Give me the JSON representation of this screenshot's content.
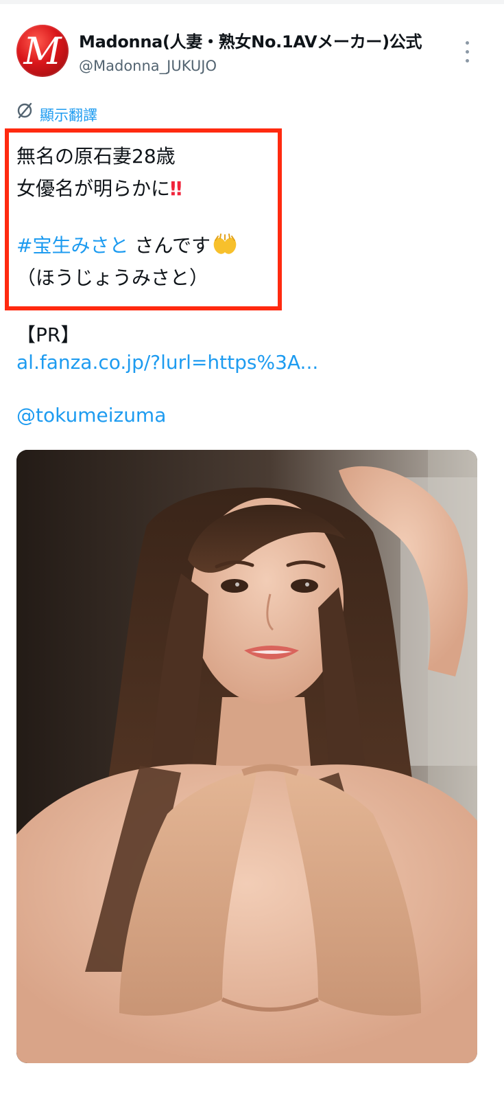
{
  "account": {
    "display_name": "Madonna(人妻・熟女No.1AVメーカー)公式",
    "handle": "@Madonna_JUKUJO",
    "avatar_letter": "M"
  },
  "translate": {
    "label": "顯示翻譯"
  },
  "tweet": {
    "line1": "無名の原石妻28歳",
    "line2": "女優名が明らかに",
    "line2_mark": "‼",
    "hashtag": "#宝生みさと",
    "line3_rest": " さんです",
    "line4": "（ほうじょうみさと）",
    "pr": "【PR】",
    "url": "al.fanza.co.jp/?lurl=https%3A...",
    "mention": "@tokumeizuma"
  },
  "colors": {
    "link": "#1d9bf0",
    "highlight": "#ff2a10",
    "text": "#0f1419",
    "secondary": "#536471"
  },
  "icons": {
    "translate": "translate-icon",
    "more": "more-vertical-icon",
    "hands": "raising-hands-emoji"
  }
}
